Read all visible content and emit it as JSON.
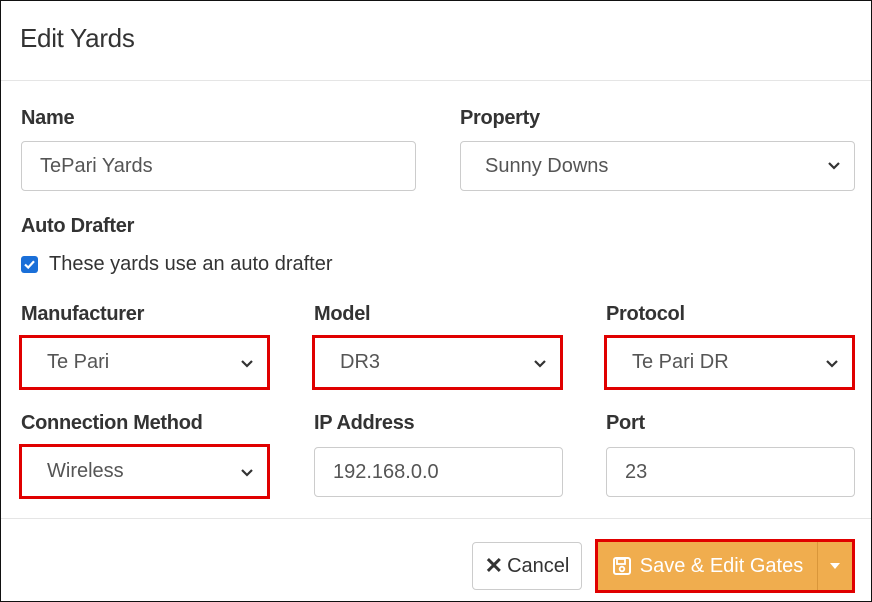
{
  "modal": {
    "title": "Edit Yards"
  },
  "form": {
    "name": {
      "label": "Name",
      "value": "TePari Yards"
    },
    "property": {
      "label": "Property",
      "value": "Sunny Downs"
    },
    "auto_drafter": {
      "label": "Auto Drafter",
      "checkbox_label": "These yards use an auto drafter",
      "checked": true
    },
    "manufacturer": {
      "label": "Manufacturer",
      "value": "Te Pari"
    },
    "model": {
      "label": "Model",
      "value": "DR3"
    },
    "protocol": {
      "label": "Protocol",
      "value": "Te Pari DR"
    },
    "connection_method": {
      "label": "Connection Method",
      "value": "Wireless"
    },
    "ip_address": {
      "label": "IP Address",
      "value": "192.168.0.0"
    },
    "port": {
      "label": "Port",
      "value": "23"
    }
  },
  "footer": {
    "cancel_label": "Cancel",
    "save_label": "Save & Edit Gates"
  },
  "colors": {
    "highlight": "#e00000",
    "save_button": "#f0ad4e",
    "checkbox": "#1a6fd8"
  }
}
